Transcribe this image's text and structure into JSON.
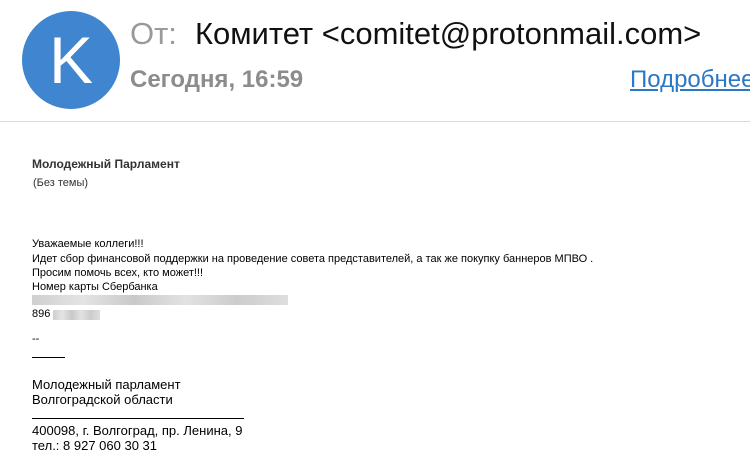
{
  "header": {
    "avatar_letter": "K",
    "from_label": "От:",
    "from_value": "Комитет <comitet@protonmail.com>",
    "date": "Сегодня, 16:59",
    "details_link": "Подробнее"
  },
  "colors": {
    "avatar": "#3f85cf",
    "link": "#2b78c5",
    "muted": "#9a9a9a"
  },
  "message": {
    "organization": "Молодежный Парламент",
    "subject": "(Без темы)",
    "lines": [
      "Уважаемые коллеги!!!",
      "Идет сбор финансовой поддержки на проведение совета представителей, а так же покупку баннеров МПВО .",
      "Просим помочь всех, кто может!!!",
      "Номер карты Сбербанка"
    ],
    "phone_prefix": "896",
    "dashes": "--",
    "signature": {
      "line1": "Молодежный парламент",
      "line2": "Волгоградской области",
      "address": "400098, г. Волгоград, пр. Ленина, 9",
      "phone": "тел.: 8 927 060 30 31"
    }
  }
}
